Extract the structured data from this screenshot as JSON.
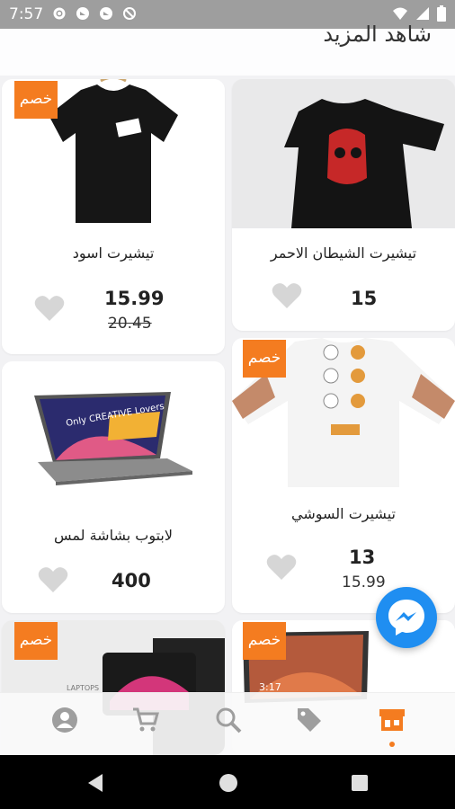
{
  "status_bar": {
    "time": "7:57"
  },
  "page": {
    "title": "شاهد المزيد"
  },
  "products": [
    {
      "name": "تيشيرت اسود",
      "price": "15.99",
      "old_price": "20.45",
      "badge": "خصم"
    },
    {
      "name": "تيشيرت الشيطان الاحمر",
      "price": "15",
      "old_price": "",
      "badge": ""
    },
    {
      "name": "لابتوب بشاشة لمس",
      "price": "400",
      "old_price": "",
      "badge": ""
    },
    {
      "name": "تيشيرت السوشي",
      "price": "13",
      "old_price": "15.99",
      "badge": "خصم"
    },
    {
      "name": "",
      "price": "",
      "old_price": "",
      "badge": "خصم",
      "image_text": "LAPTOPS"
    },
    {
      "name": "",
      "price": "",
      "old_price": "",
      "badge": "خصم",
      "image_text": "3:17"
    }
  ],
  "laptop_screen_text": "Only CREATIVE Lovers",
  "bottom_nav": {
    "items": [
      "profile-icon",
      "cart-icon",
      "search-icon",
      "tag-icon",
      "store-icon"
    ],
    "active": "store-icon"
  },
  "colors": {
    "accent": "#f47c20",
    "messenger": "#1f8ef1",
    "heart": "#d6d6d6"
  }
}
